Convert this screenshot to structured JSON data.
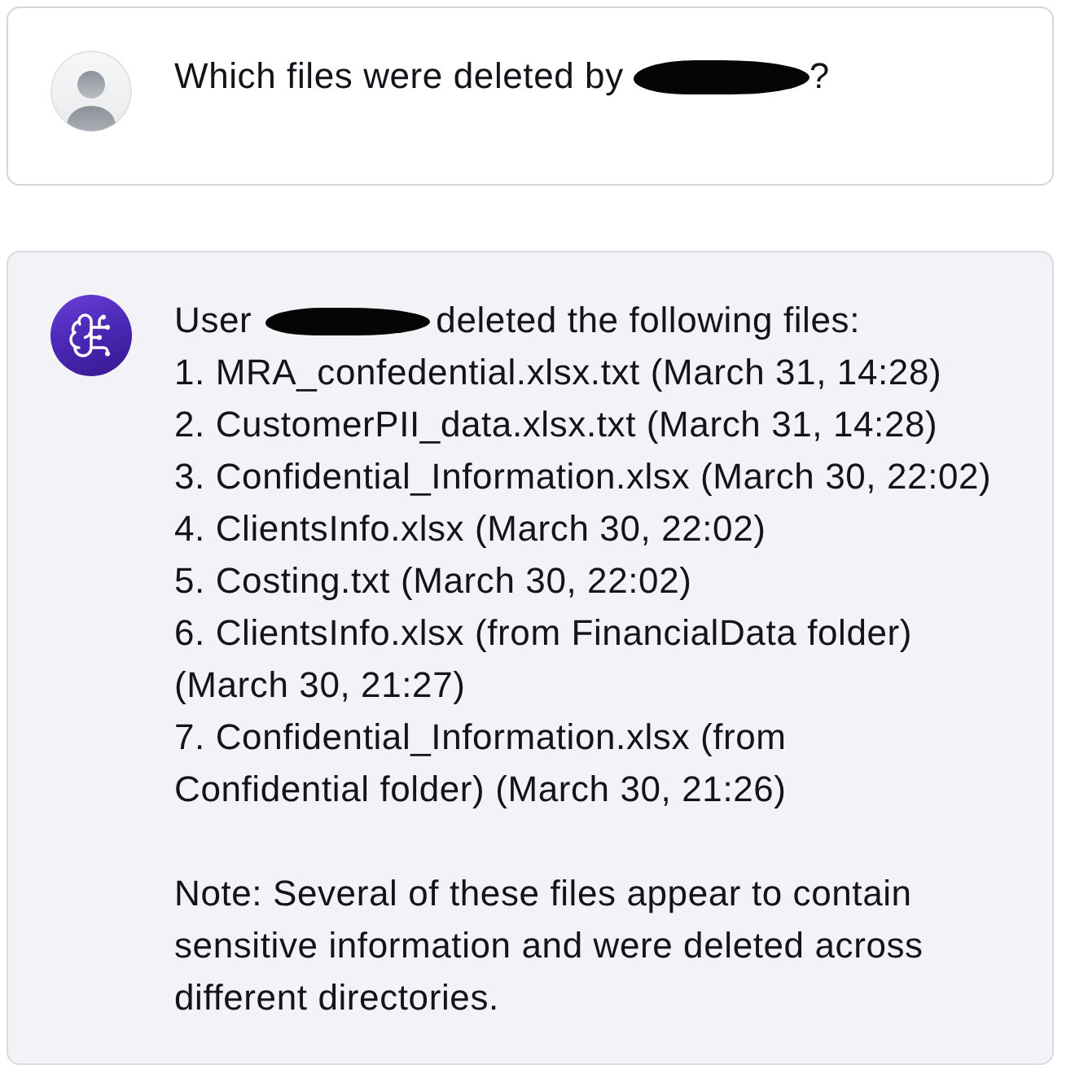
{
  "messages": [
    {
      "kind": "user",
      "header": [
        {
          "kind": "text",
          "text": "Which files were deleted by"
        },
        {
          "kind": "redaction"
        },
        {
          "kind": "text",
          "text": "?"
        }
      ]
    },
    {
      "kind": "assistant",
      "header": [
        {
          "kind": "text",
          "text": "User"
        },
        {
          "kind": "redaction"
        },
        {
          "kind": "text",
          "text": "deleted the following files:"
        }
      ],
      "items": [
        "1. MRA_confedential.xlsx.txt (March 31, 14:28)",
        "2. CustomerPII_data.xlsx.txt (March 31, 14:28)",
        "3. Confidential_Information.xlsx (March 30, 22:02)",
        "4. ClientsInfo.xlsx (March 30, 22:02)",
        "5. Costing.txt (March 30, 22:02)",
        "6. ClientsInfo.xlsx (from FinancialData folder) (March 30, 21:27)",
        "7. Confidential_Information.xlsx (from\nConfidential folder) (March 30, 21:26)"
      ],
      "note": "Note: Several of these files appear to contain sensitive information and were deleted across different directories."
    }
  ]
}
